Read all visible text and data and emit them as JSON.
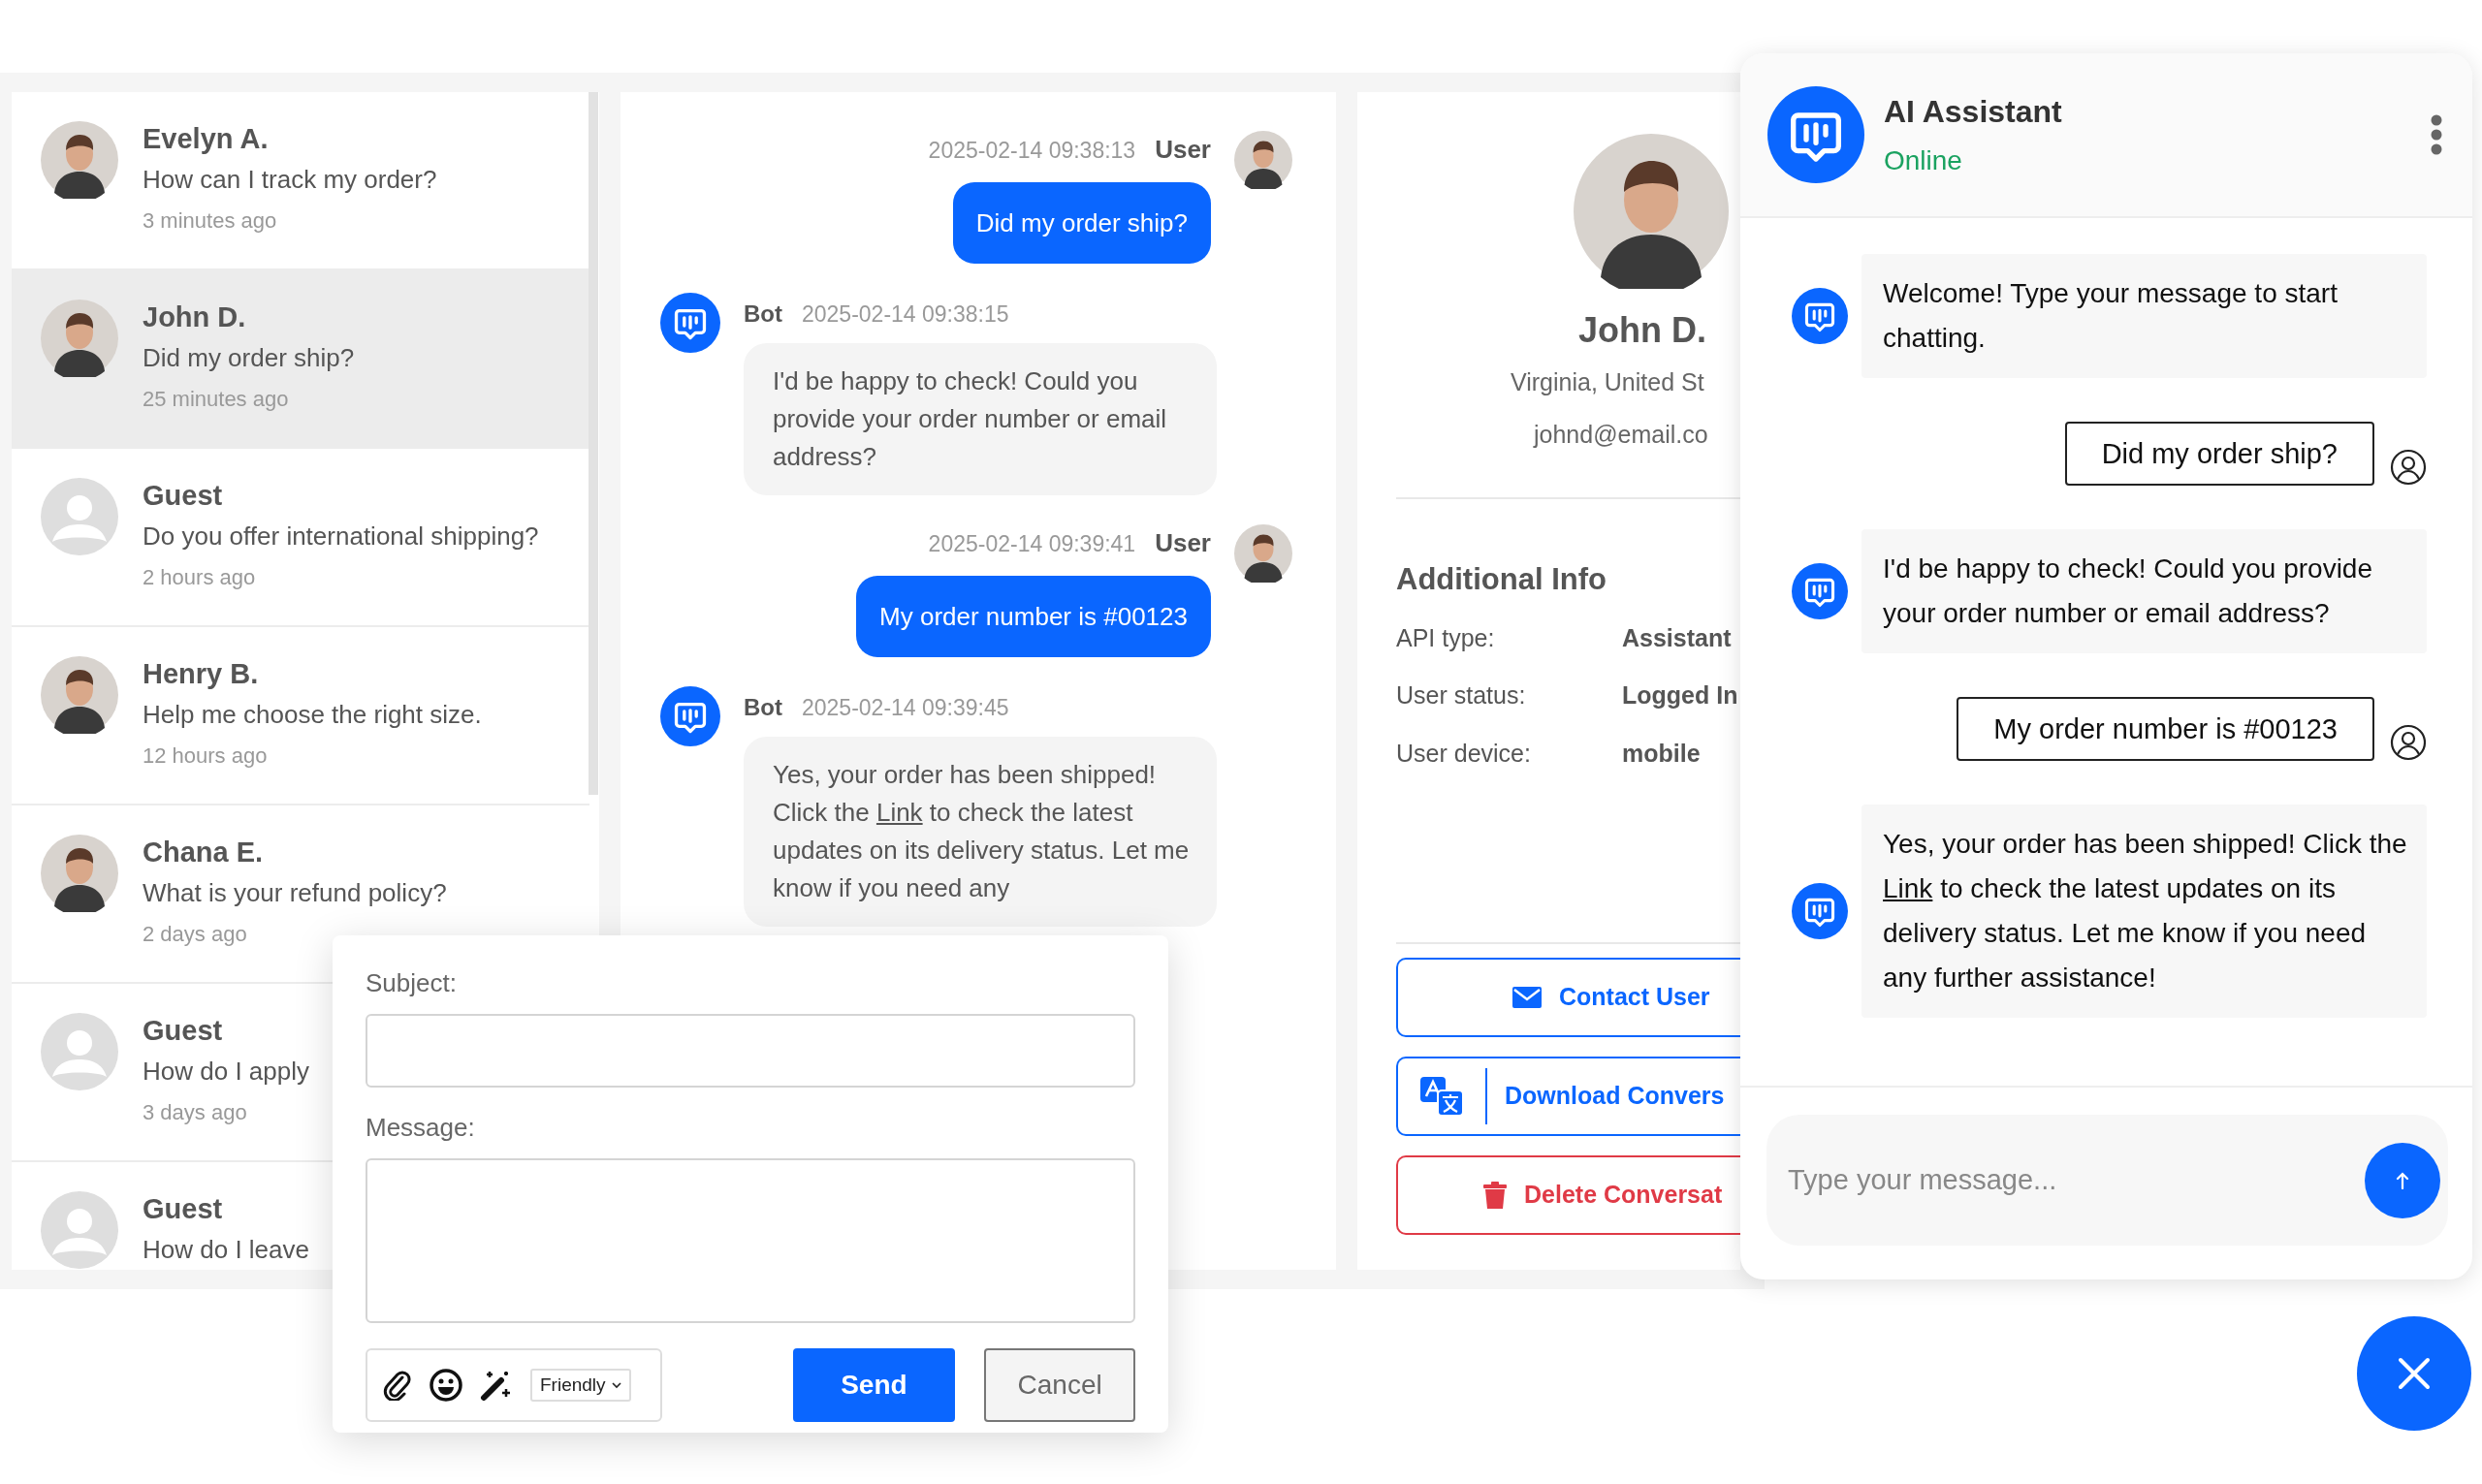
{
  "conversations": [
    {
      "kind": "photo",
      "name": "Evelyn A.",
      "preview": "How can I track my order?",
      "time": "3 minutes ago",
      "selected": false
    },
    {
      "kind": "photo",
      "name": "John D.",
      "preview": "Did my order ship?",
      "time": "25 minutes ago",
      "selected": true
    },
    {
      "kind": "guest",
      "name": "Guest",
      "preview": "Do you offer international shipping?",
      "time": "2 hours ago",
      "selected": false
    },
    {
      "kind": "photo",
      "name": "Henry B.",
      "preview": "Help me choose the right size.",
      "time": "12 hours ago",
      "selected": false
    },
    {
      "kind": "photo",
      "name": "Chana E.",
      "preview": "What is your refund policy?",
      "time": "2 days ago",
      "selected": false
    },
    {
      "kind": "guest",
      "name": "Guest",
      "preview": "How do I apply",
      "time": "3 days ago",
      "selected": false
    },
    {
      "kind": "guest",
      "name": "Guest",
      "preview": "How do I leave",
      "selected": false
    }
  ],
  "chat": {
    "messages": [
      {
        "kind": "user",
        "time": "2025-02-14 09:38:13",
        "sender": "User",
        "parts": [
          {
            "text": "Did my order ship?"
          }
        ]
      },
      {
        "kind": "bot",
        "time": "2025-02-14 09:38:15",
        "sender": "Bot",
        "parts": [
          {
            "text": "I'd be happy to check! Could you provide your order number or email address?"
          }
        ]
      },
      {
        "kind": "user",
        "time": "2025-02-14 09:39:41",
        "sender": "User",
        "parts": [
          {
            "text": "My order number is #00123"
          }
        ]
      },
      {
        "kind": "bot",
        "time": "2025-02-14 09:39:45",
        "sender": "Bot",
        "parts": [
          {
            "text": "Yes, your order has been shipped! Click the"
          },
          {
            "link": "Link"
          },
          {
            "text": "to check the latest updates on its delivery status. Let me know if you need any"
          }
        ]
      }
    ]
  },
  "profile": {
    "name": "John D.",
    "location": "Virginia, United St",
    "email": "johnd@email.co",
    "section_title": "Additional Info",
    "info": [
      {
        "label": "API type:",
        "value": "Assistant"
      },
      {
        "label": "User status:",
        "value": "Logged In"
      },
      {
        "label": "User device:",
        "value": "mobile"
      }
    ],
    "actions": [
      {
        "kind": "contact",
        "label": "Contact User"
      },
      {
        "kind": "download",
        "label": "Download Convers"
      },
      {
        "kind": "delete",
        "label": "Delete Conversat"
      }
    ]
  },
  "email_form": {
    "subject_label": "Subject:",
    "message_label": "Message:",
    "tone": "Friendly",
    "send": "Send",
    "cancel": "Cancel"
  },
  "assistant": {
    "title": "AI Assistant",
    "status": "Online",
    "messages": [
      {
        "kind": "bot",
        "parts": [
          {
            "text": "Welcome! Type your message to start chatting."
          }
        ]
      },
      {
        "kind": "user",
        "parts": [
          {
            "text": "Did my order ship?"
          }
        ]
      },
      {
        "kind": "bot",
        "parts": [
          {
            "text": "I'd be happy to check! Could you provide your order number or email address?"
          }
        ]
      },
      {
        "kind": "user",
        "parts": [
          {
            "text": "My order number is #00123"
          }
        ]
      },
      {
        "kind": "bot",
        "parts": [
          {
            "text": "Yes, your order has been shipped! Click the"
          },
          {
            "link": "Link"
          },
          {
            "text": "to check the latest updates on its delivery status. Let me know if you need any further assistance!"
          }
        ]
      }
    ],
    "input_placeholder": "Type your message..."
  }
}
